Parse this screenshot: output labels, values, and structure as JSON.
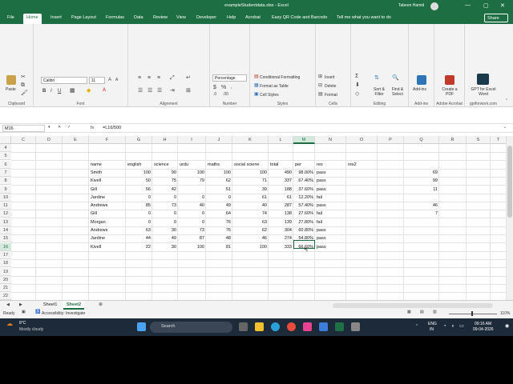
{
  "window": {
    "title": "exampleStudentdata.xlsx - Excel",
    "user": "Tabeen Hamid",
    "controls": [
      "—",
      "▢",
      "✕"
    ]
  },
  "menu": {
    "tabs": [
      "File",
      "Home",
      "Insert",
      "Page Layout",
      "Formulas",
      "Data",
      "Review",
      "View",
      "Developer",
      "Help",
      "Acrobat",
      "Easy QR Code and Barcode"
    ],
    "active": "Home",
    "search": "Tell me what you want to do",
    "share": "Share"
  },
  "ribbon": {
    "clipboard": {
      "paste": "Paste",
      "label": "Clipboard"
    },
    "font": {
      "name": "Calibri",
      "size": "11",
      "label": "Font"
    },
    "alignment": {
      "label": "Alignment"
    },
    "number": {
      "format": "Percentage",
      "label": "Number"
    },
    "styles": {
      "conditional": "Conditional Formatting",
      "table": "Format as Table",
      "cell": "Cell Styles",
      "label": "Styles"
    },
    "cells": {
      "insert": "Insert",
      "delete": "Delete",
      "format": "Format",
      "label": "Cells"
    },
    "editing": {
      "sort": "Sort & Filter",
      "find": "Find & Select",
      "label": "Editing"
    },
    "addins": {
      "addins": "Add-ins",
      "label": "Add-ins"
    },
    "acrobat": {
      "create": "Create a PDF",
      "label": "Adobe Acrobat"
    },
    "gpt": {
      "name": "GPT for Excel Word",
      "label": "gptforwork.com"
    }
  },
  "formula_bar": {
    "name_box": "M16",
    "fx": "fx",
    "formula": "=L16/500"
  },
  "sheet": {
    "columns": [
      "C",
      "D",
      "E",
      "F",
      "G",
      "H",
      "I",
      "J",
      "K",
      "L",
      "M",
      "N",
      "O",
      "P",
      "Q",
      "R",
      "S",
      "T"
    ],
    "rows": [
      "4",
      "5",
      "6",
      "7",
      "8",
      "9",
      "10",
      "11",
      "12",
      "13",
      "14",
      "15",
      "16",
      "17",
      "18",
      "19",
      "20",
      "21",
      "22"
    ],
    "selected_col": "M",
    "selected_row": "16",
    "header": {
      "name": "name",
      "english": "english",
      "science": "science",
      "urdu": "urdu",
      "maths": "maths",
      "social": "social sciene",
      "total": "total",
      "per": "per",
      "res": "res",
      "res2": "res2"
    },
    "students": [
      {
        "name": "Smith",
        "english": "100",
        "science": "90",
        "urdu": "100",
        "maths": "100",
        "social": "100",
        "total": "490",
        "per": "98.00%",
        "res": "pass",
        "q": "69"
      },
      {
        "name": "Kivell",
        "english": "50",
        "science": "75",
        "urdu": "79",
        "maths": "62",
        "social": "71",
        "total": "337",
        "per": "67.40%",
        "res": "pass",
        "q": "99"
      },
      {
        "name": "Gill",
        "english": "56",
        "science": "42",
        "urdu": "",
        "maths": "51",
        "social": "39",
        "total": "188",
        "per": "37.60%",
        "res": "pass",
        "q": "11"
      },
      {
        "name": "Jardine",
        "english": "0",
        "science": "0",
        "urdu": "0",
        "maths": "0",
        "social": "61",
        "total": "61",
        "per": "12.20%",
        "res": "fail",
        "q": ""
      },
      {
        "name": "Andrews",
        "english": "85",
        "science": "73",
        "urdu": "40",
        "maths": "49",
        "social": "40",
        "total": "287",
        "per": "57.40%",
        "res": "pass",
        "q": "46"
      },
      {
        "name": "Gill",
        "english": "0",
        "science": "0",
        "urdu": "0",
        "maths": "64",
        "social": "74",
        "total": "138",
        "per": "27.60%",
        "res": "fail",
        "q": "7"
      },
      {
        "name": "Morgan",
        "english": "0",
        "science": "0",
        "urdu": "0",
        "maths": "76",
        "social": "63",
        "total": "139",
        "per": "27.80%",
        "res": "fail",
        "q": ""
      },
      {
        "name": "Andrews",
        "english": "63",
        "science": "30",
        "urdu": "73",
        "maths": "76",
        "social": "62",
        "total": "304",
        "per": "60.80%",
        "res": "pass",
        "q": ""
      },
      {
        "name": "Jardine",
        "english": "44",
        "science": "49",
        "urdu": "87",
        "maths": "48",
        "social": "46",
        "total": "274",
        "per": "54.80%",
        "res": "pass",
        "q": ""
      },
      {
        "name": "Kivell",
        "english": "22",
        "science": "30",
        "urdu": "100",
        "maths": "81",
        "social": "100",
        "total": "333",
        "per": "66.60%",
        "res": "pass",
        "q": ""
      }
    ]
  },
  "sheet_tabs": {
    "tabs": [
      "Sheet1",
      "Sheet2"
    ],
    "active": "Sheet2"
  },
  "status": {
    "ready": "Ready",
    "accessibility": "Accessibility: Investigate",
    "zoom": "110%"
  },
  "taskbar": {
    "temp": "8°C",
    "weather": "Mostly cloudy",
    "search": "Search",
    "lang": "ENG",
    "region": "IN",
    "time": "09:16 AM",
    "date": "09-04-2026"
  }
}
